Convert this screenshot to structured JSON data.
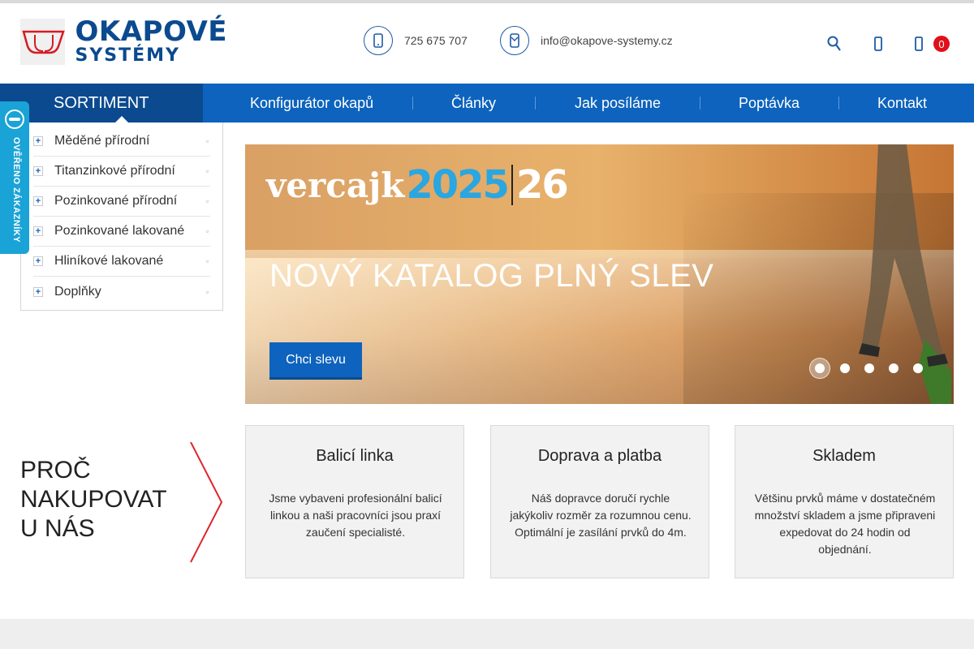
{
  "logo": {
    "line1": "OKAPOVÉ",
    "line2": "SYSTÉMY"
  },
  "header": {
    "phone": "725 675 707",
    "email": "info@okapove-systemy.cz",
    "phone_icon": "phone-icon",
    "email_icon": "mail-icon",
    "cart_count": "0"
  },
  "nav": {
    "sortiment": "SORTIMENT",
    "items": [
      {
        "label": "Konfigurátor okapů"
      },
      {
        "label": "Články"
      },
      {
        "label": "Jak posíláme"
      },
      {
        "label": "Poptávka"
      },
      {
        "label": "Kontakt"
      }
    ]
  },
  "sidebar": {
    "items": [
      {
        "label": "Měděné přírodní"
      },
      {
        "label": "Titanzinkové přírodní"
      },
      {
        "label": "Pozinkované přírodní"
      },
      {
        "label": "Pozinkované lakované"
      },
      {
        "label": "Hliníkové lakované"
      },
      {
        "label": "Doplňky"
      }
    ],
    "plus": "+",
    "arrow": "▫"
  },
  "verified": {
    "text": "OVĚŘENO ZÁKAZNÍKY"
  },
  "hero": {
    "brand_word": "vercajk",
    "brand_year1": "2025",
    "brand_year2": "26",
    "headline": "NOVÝ KATALOG PLNÝ SLEV",
    "cta": "Chci slevu",
    "slide_count": 5,
    "active_slide": 1
  },
  "why": {
    "line1": "PROČ",
    "line2": "NAKUPOVAT",
    "line3": "U NÁS"
  },
  "features": [
    {
      "title": "Balicí linka",
      "text": "Jsme vybaveni profesionální balicí linkou a naši pracovníci jsou praxí zaučení specialisté."
    },
    {
      "title": "Doprava a platba",
      "text": "Náš dopravce doručí rychle jakýkoliv rozměr za rozumnou cenu. Optimální je zasílání prvků do 4m."
    },
    {
      "title": "Skladem",
      "text": "Většinu prvků máme v dostatečném množství skladem a jsme připraveni expedovat do 24 hodin od objednání."
    }
  ],
  "colors": {
    "brand_blue": "#0b4a8f",
    "nav_blue": "#0d63bd",
    "accent_red": "#e0101a",
    "badge_blue": "#1aa3d6"
  }
}
